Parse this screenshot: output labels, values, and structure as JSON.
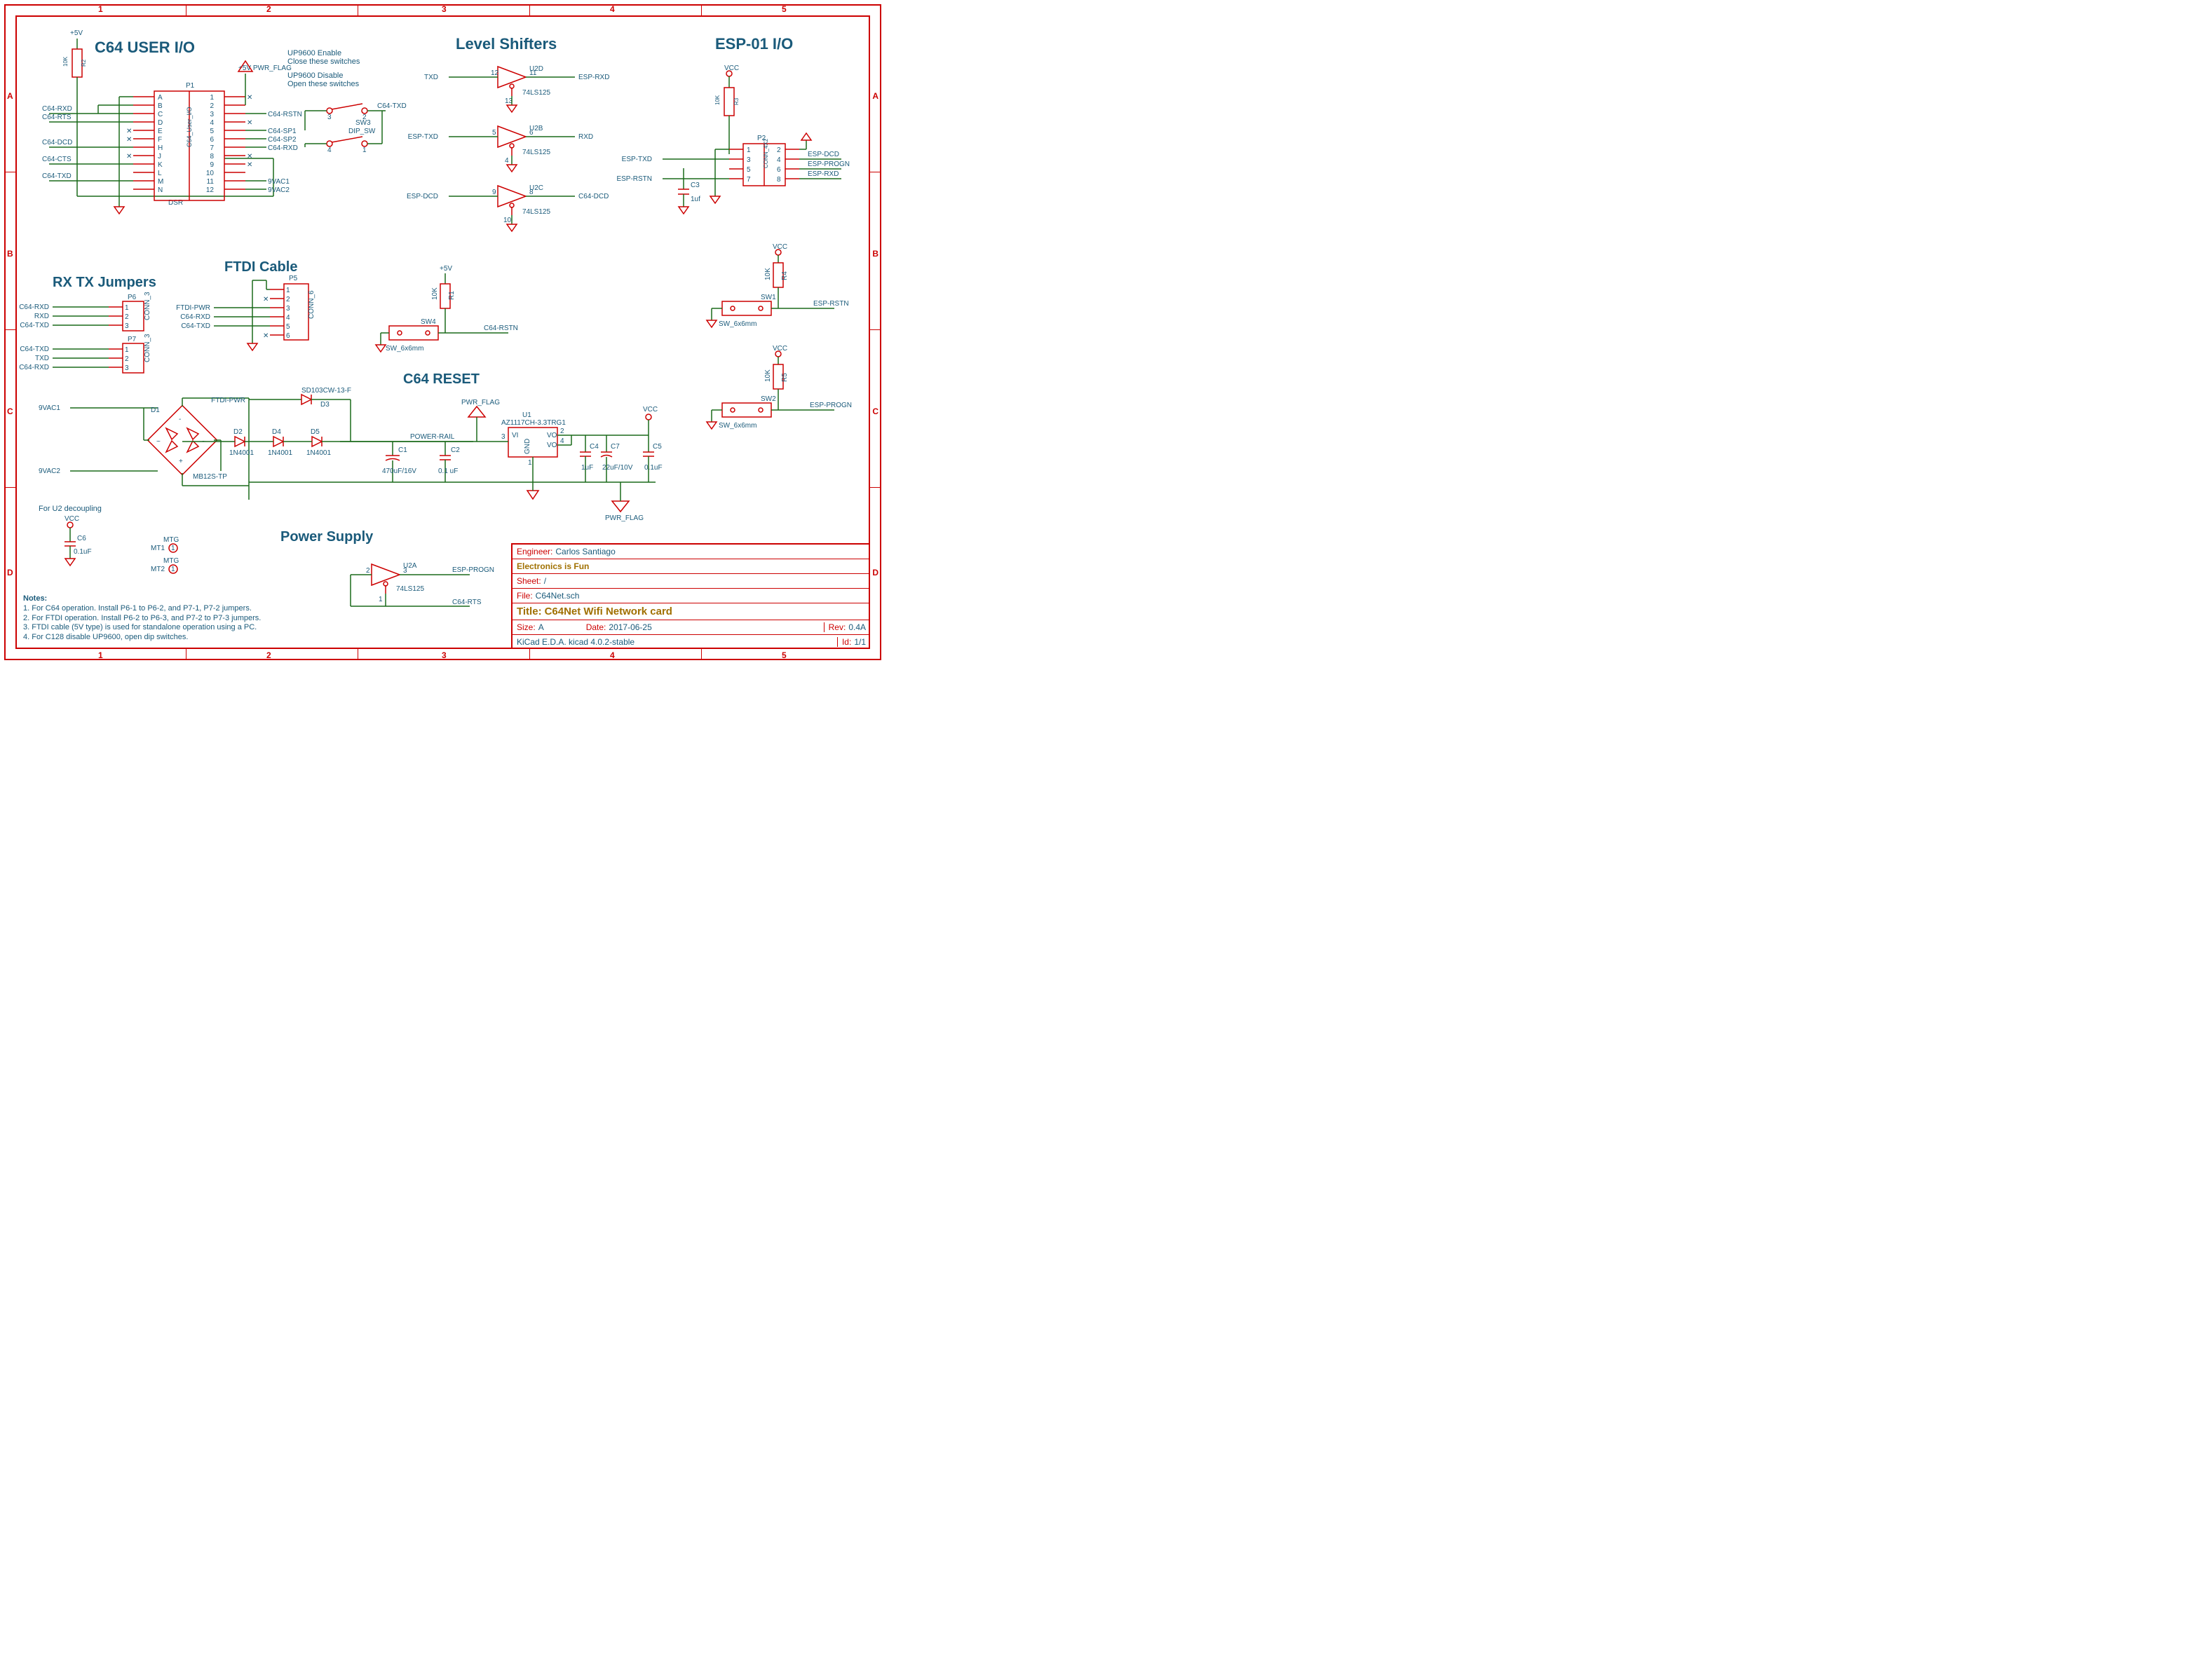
{
  "meta": {
    "domain": "Diagram",
    "tool": "KiCad E.D.A. kicad 4.0.2-stable"
  },
  "ruler": {
    "top": [
      "1",
      "2",
      "3",
      "4",
      "5"
    ],
    "left": [
      "A",
      "B",
      "C",
      "D"
    ]
  },
  "sections": {
    "user_io": "C64 USER I/O",
    "level_shifters": "Level Shifters",
    "esp_io": "ESP-01 I/O",
    "rx_tx": "RX TX Jumpers",
    "ftdi": "FTDI Cable",
    "c64_reset": "C64 RESET",
    "power": "Power Supply"
  },
  "up9600": {
    "enable": "UP9600 Enable\nClose these switches",
    "disable": "UP9600 Disable\nOpen these switches",
    "sw": "SW3",
    "sw_type": "DIP_SW"
  },
  "p1": {
    "ref": "P1",
    "part": "C64_User_I/O",
    "pwr": "+5V PWR_FLAG",
    "left_nets": [
      "C64-RXD",
      "C64-RTS",
      "",
      "",
      "C64-DCD",
      "",
      "C64-CTS",
      "",
      "C64-TXD"
    ],
    "left_pins": [
      "A",
      "B",
      "C",
      "D",
      "E",
      "F",
      "H",
      "J",
      "K",
      "L",
      "M",
      "N"
    ],
    "right_pins": [
      "1",
      "2",
      "3",
      "4",
      "5",
      "6",
      "7",
      "8",
      "9",
      "10",
      "11",
      "12"
    ],
    "right_nets": [
      "",
      "",
      "C64-RSTN",
      "",
      "C64-SP1",
      "C64-SP2",
      "C64-RXD",
      "",
      "",
      "",
      "9VAC1",
      "9VAC2"
    ],
    "r2": {
      "ref": "R2",
      "val": "10K",
      "rail": "+5V"
    },
    "dsr": "DSR",
    "sw3_net": "C64-TXD"
  },
  "shifters": {
    "u2d": {
      "ref": "U2D",
      "part": "74LS125",
      "pin_in": "12",
      "pin_out": "11",
      "pin_en": "13",
      "in": "TXD",
      "out": "ESP-RXD"
    },
    "u2b": {
      "ref": "U2B",
      "part": "74LS125",
      "pin_in": "5",
      "pin_out": "6",
      "pin_en": "4",
      "in": "ESP-TXD",
      "out": "RXD"
    },
    "u2c": {
      "ref": "U2C",
      "part": "74LS125",
      "pin_in": "9",
      "pin_out": "8",
      "pin_en": "10",
      "in": "ESP-DCD",
      "out": "C64-DCD"
    },
    "u2a": {
      "ref": "U2A",
      "part": "74LS125",
      "pin_in": "2",
      "pin_out": "3",
      "pin_en": "1",
      "in": "",
      "out": "ESP-PROGN",
      "below": "C64-RTS"
    }
  },
  "esp": {
    "p2": {
      "ref": "P2",
      "part": "CONN_4X2",
      "left_pins": [
        "1",
        "3",
        "5",
        "7"
      ],
      "right_pins": [
        "2",
        "4",
        "6",
        "8"
      ],
      "left_nets": [
        "ESP-TXD",
        "",
        "",
        "ESP-RSTN"
      ],
      "right_nets": [
        "",
        "ESP-DCD",
        "ESP-PROGN",
        "ESP-RXD"
      ]
    },
    "r3": {
      "ref": "R3",
      "val": "10K",
      "rail": "VCC"
    },
    "c3": {
      "ref": "C3",
      "val": "1uf"
    },
    "sw1": {
      "ref": "SW1",
      "part": "SW_6x6mm",
      "net": "ESP-RSTN",
      "r": {
        "ref": "R4",
        "val": "10K",
        "rail": "VCC"
      }
    },
    "sw2": {
      "ref": "SW2",
      "part": "SW_6x6mm",
      "net": "ESP-PROGN",
      "r": {
        "ref": "R5",
        "val": "10K",
        "rail": "VCC"
      }
    }
  },
  "rxtx": {
    "p6": {
      "ref": "P6",
      "part": "CONN_3",
      "nets": [
        "C64-RXD",
        "RXD",
        "C64-TXD"
      ],
      "pins": [
        "1",
        "2",
        "3"
      ]
    },
    "p7": {
      "ref": "P7",
      "part": "CONN_3",
      "nets": [
        "C64-TXD",
        "TXD",
        "C64-RXD"
      ],
      "pins": [
        "1",
        "2",
        "3"
      ]
    }
  },
  "ftdi": {
    "p5": {
      "ref": "P5",
      "part": "CONN_6",
      "pins": [
        "1",
        "2",
        "3",
        "4",
        "5",
        "6"
      ],
      "nets": [
        "",
        "",
        "FTDI-PWR",
        "C64-RXD",
        "C64-TXD",
        ""
      ]
    }
  },
  "reset": {
    "rail": "+5V",
    "sw4": {
      "ref": "SW4",
      "part": "SW_6x6mm"
    },
    "r1": {
      "ref": "R1",
      "val": "10K"
    },
    "net": "C64-RSTN"
  },
  "power": {
    "in1": "9VAC1",
    "in2": "9VAC2",
    "d1": {
      "ref": "D1",
      "part": "MB12S-TP"
    },
    "d2": {
      "ref": "D2",
      "part": "1N4001"
    },
    "d4": {
      "ref": "D4",
      "part": "1N4001"
    },
    "d5": {
      "ref": "D5",
      "part": "1N4001"
    },
    "d3": {
      "ref": "D3",
      "part": "SD103CW-13-F",
      "net": "FTDI-PWR"
    },
    "rail": "POWER-RAIL",
    "c1": {
      "ref": "C1",
      "val": "470uF/16V"
    },
    "c2": {
      "ref": "C2",
      "val": "0.1 uF"
    },
    "u1": {
      "ref": "U1",
      "part": "AZ1117CH-3.3TRG1",
      "pins": {
        "vi": "3",
        "gnd": "1",
        "vo": "2",
        "vo2": "4"
      },
      "labels": {
        "vi": "VI",
        "gnd": "GND",
        "vo": "VO",
        "vo2": "VO"
      }
    },
    "c4": {
      "ref": "C4",
      "val": "1uF"
    },
    "c7": {
      "ref": "C7",
      "val": "22uF/10V"
    },
    "c5": {
      "ref": "C5",
      "val": "0.1uF"
    },
    "pwr_flag": "PWR_FLAG",
    "vcc": "VCC"
  },
  "decoupling": {
    "title": "For U2 decoupling",
    "vcc": "VCC",
    "c6": {
      "ref": "C6",
      "val": "0.1uF"
    }
  },
  "mtg": {
    "mt1": {
      "ref": "MT1",
      "label": "MTG"
    },
    "mt2": {
      "ref": "MT2",
      "label": "MTG"
    }
  },
  "notes": {
    "heading": "Notes:",
    "n1": "1. For C64 operation. Install P6-1 to P6-2, and P7-1, P7-2 jumpers.",
    "n2": "2. For FTDI operation. Install P6-2 to P6-3, and P7-2 to P7-3 jumpers.",
    "n3": "3. FTDI cable (5V type) is used for standalone operation using a PC.",
    "n4": "4. For C128 disable UP9600, open dip switches."
  },
  "titleblock": {
    "engineer_label": "Engineer:",
    "engineer": "Carlos Santiago",
    "org": "Electronics is Fun",
    "sheet_label": "Sheet:",
    "sheet": "/",
    "file_label": "File:",
    "file": "C64Net.sch",
    "title_label": "Title:",
    "title": "C64Net Wifi Network card",
    "size_label": "Size:",
    "size": "A",
    "date_label": "Date:",
    "date": "2017-06-25",
    "rev_label": "Rev:",
    "rev": "0.4A",
    "gen": "KiCad E.D.A.  kicad 4.0.2-stable",
    "id_label": "Id:",
    "id": "1/1"
  }
}
